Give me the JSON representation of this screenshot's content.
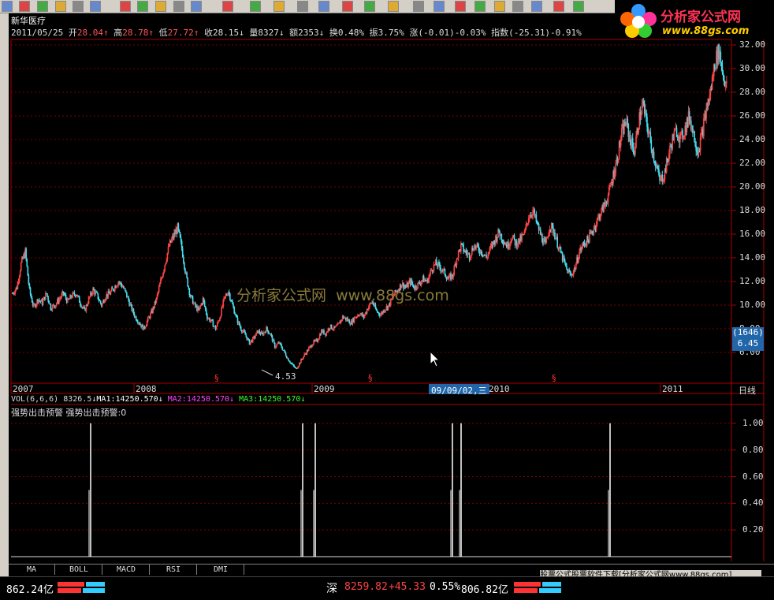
{
  "stock": {
    "name": "新华医疗",
    "date": "2011/05/25",
    "open_label": "开",
    "open": "28.04",
    "high_label": "高",
    "high": "28.78",
    "low_label": "低",
    "low": "27.72",
    "close_label": "收",
    "close": "28.15",
    "volume_label": "量",
    "volume": "8327",
    "amount_label": "额",
    "amount": "2353",
    "turnover_label": "换",
    "turnover": "0.48%",
    "amplitude_label": "振",
    "amplitude": "3.75%",
    "change_label": "涨",
    "change": "(-0.01)-0.03%",
    "index_label": "指数",
    "index": "(-25.31)-0.91%"
  },
  "logo": {
    "title": "分析家公式网",
    "url": "www.88gs.com"
  },
  "watermark": {
    "cn": "分析家公式网",
    "url": "www.88gs.com"
  },
  "price_axis": [
    "32.00",
    "30.00",
    "28.00",
    "26.00",
    "24.00",
    "22.00",
    "20.00",
    "18.00",
    "16.00",
    "14.00",
    "12.00",
    "10.00",
    "8.00",
    "6.00"
  ],
  "price_marker": {
    "line1": "(1646)",
    "line2": "6.45"
  },
  "low_label": "4.53",
  "time_axis": {
    "labels": [
      "2007",
      "2008",
      "2009",
      "2010",
      "2011"
    ],
    "cursor_date": "09/09/02,三",
    "period": "日线"
  },
  "vol_line": {
    "text": "VOL(6,6,6)",
    "value": "8326.5",
    "ma1_label": "MA1:",
    "ma1": "14250.570",
    "ma2_label": "MA2:",
    "ma2": "14250.570",
    "ma3_label": "MA3:",
    "ma3": "14250.570"
  },
  "indicator": {
    "title": "强势出击预警",
    "signal_label": "强势出击预警:",
    "signal_value": "0"
  },
  "indicator_axis": [
    "1.00",
    "0.80",
    "0.60",
    "0.40",
    "0.20"
  ],
  "tabs": [
    "MA",
    "BOLL",
    "MACD",
    "RSI",
    "DMI"
  ],
  "status": {
    "left_value": "862.24亿",
    "market": "深",
    "index": "8259.82",
    "change": "+45.33",
    "pct": "0.55%",
    "amount": "806.82亿",
    "ad_text": "股票公式股票软件下载[分析家公式网www.88gs.com]"
  },
  "chart_data": {
    "type": "candlestick",
    "title": "新华医疗",
    "ylim": [
      3.6,
      32.0
    ],
    "x_labels": [
      "2007",
      "2008",
      "2009",
      "2010",
      "2011"
    ],
    "low_marker": 4.53,
    "close_series_approx": [
      11.0,
      11.5,
      13.5,
      14.5,
      11.2,
      9.8,
      10.5,
      10.2,
      11.0,
      9.8,
      10.0,
      10.5,
      11.0,
      10.3,
      10.8,
      11.0,
      10.2,
      9.5,
      10.5,
      11.3,
      10.8,
      10.0,
      10.8,
      11.0,
      11.5,
      12.0,
      11.6,
      10.8,
      9.8,
      9.0,
      8.5,
      8.0,
      8.8,
      9.5,
      10.5,
      12.0,
      13.5,
      15.0,
      15.8,
      16.5,
      14.8,
      12.5,
      10.8,
      10.0,
      9.5,
      10.5,
      9.0,
      8.6,
      8.0,
      9.0,
      10.5,
      11.2,
      10.0,
      8.8,
      8.0,
      7.5,
      6.8,
      7.2,
      7.8,
      7.5,
      8.0,
      7.5,
      6.5,
      6.8,
      6.2,
      5.5,
      5.0,
      4.6,
      5.2,
      5.8,
      6.3,
      6.8,
      7.0,
      7.8,
      7.6,
      8.2,
      8.0,
      8.3,
      9.0,
      8.8,
      8.5,
      9.0,
      9.3,
      9.0,
      9.8,
      10.3,
      9.5,
      9.2,
      9.7,
      10.0,
      10.8,
      11.3,
      11.8,
      11.5,
      12.0,
      11.5,
      11.8,
      12.2,
      12.0,
      13.0,
      13.5,
      13.2,
      12.8,
      12.2,
      12.5,
      14.0,
      15.0,
      14.5,
      14.2,
      15.0,
      14.8,
      14.5,
      14.0,
      14.8,
      15.5,
      16.2,
      15.5,
      15.0,
      15.8,
      15.2,
      15.5,
      16.0,
      17.5,
      18.0,
      16.8,
      15.8,
      15.0,
      16.8,
      16.2,
      15.0,
      14.0,
      13.0,
      12.5,
      13.2,
      14.5,
      15.2,
      15.5,
      16.2,
      17.0,
      17.8,
      18.5,
      19.5,
      21.0,
      22.5,
      24.5,
      25.5,
      24.0,
      23.0,
      25.5,
      27.0,
      25.2,
      23.5,
      22.0,
      20.5,
      21.0,
      22.5,
      24.0,
      24.8,
      24.0,
      25.0,
      26.0,
      24.5,
      23.0,
      24.5,
      26.5,
      28.0,
      30.5,
      31.5,
      29.5,
      28.15
    ]
  },
  "indicator_data": {
    "type": "bar",
    "ylim": [
      0,
      1.1
    ],
    "signals": [
      1,
      1,
      1,
      1,
      1,
      1
    ]
  }
}
